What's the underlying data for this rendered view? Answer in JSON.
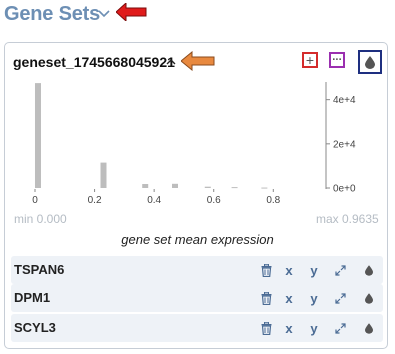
{
  "header": {
    "title": "Gene Sets"
  },
  "geneset": {
    "name": "geneset_1745668045921",
    "add_symbol": "+",
    "more_symbol": "···"
  },
  "histogram": {
    "min_label": "min 0.000",
    "max_label": "max 0.9635",
    "x_title": "gene set mean expression"
  },
  "genes": [
    {
      "name": "TSPAN6",
      "x_label": "x",
      "y_label": "y"
    },
    {
      "name": "DPM1",
      "x_label": "x",
      "y_label": "y"
    },
    {
      "name": "SCYL3",
      "x_label": "x",
      "y_label": "y"
    }
  ],
  "icons": [
    "chevron-down-icon",
    "arrow-annotation-icon",
    "chevron-up-icon",
    "plus-icon",
    "ellipsis-icon",
    "droplet-icon",
    "trash-icon",
    "expand-icon"
  ],
  "colors": {
    "title": "#6d8fb4",
    "annotation_arrow_red": "#e01b1b",
    "annotation_arrow_orange": "#e8893f",
    "add_box": "#d42c2c",
    "more_box": "#9b2fb0",
    "color_box": "#1e2f80",
    "bars": "#bdbdbd",
    "row_bg": "#eef2f7",
    "icon": "#4a6b94"
  },
  "chart_data": {
    "type": "bar",
    "title": "",
    "xlabel": "gene set mean expression",
    "ylabel": "",
    "x_ticks": [
      "0",
      "0.2",
      "0.4",
      "0.6",
      "0.8"
    ],
    "y_ticks": [
      "0e+0",
      "2e+4",
      "4e+4"
    ],
    "xlim": [
      0,
      0.9635
    ],
    "ylim": [
      0,
      48000
    ],
    "bins": [
      0.01,
      0.23,
      0.37,
      0.47,
      0.58,
      0.67,
      0.77
    ],
    "values": [
      47500,
      11500,
      1800,
      1900,
      600,
      400,
      200
    ]
  }
}
